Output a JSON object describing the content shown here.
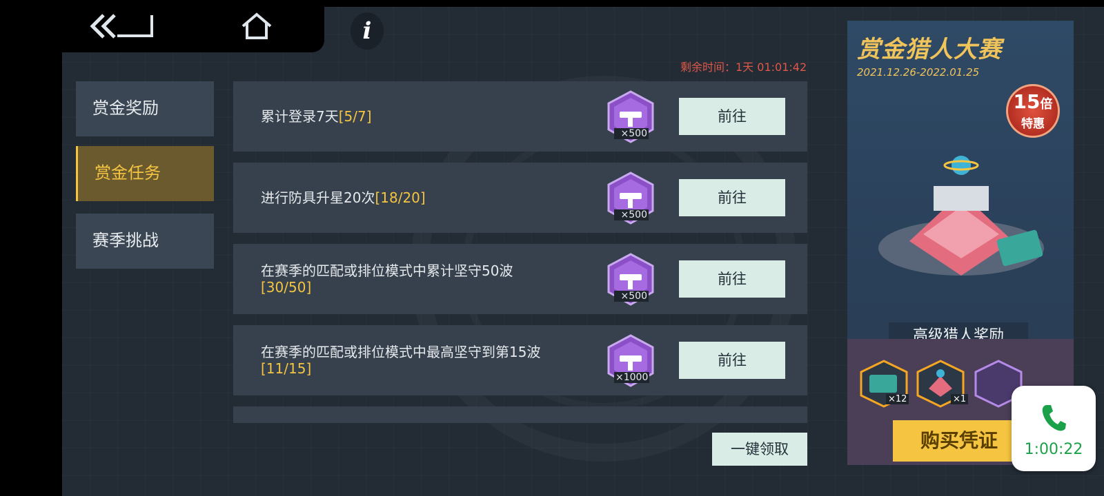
{
  "header": {
    "back_icon": "double-chevron-back-icon",
    "home_icon": "home-icon",
    "info_label": "i"
  },
  "tabs": [
    {
      "label": "赏金奖励",
      "active": false
    },
    {
      "label": "赏金任务",
      "active": true
    },
    {
      "label": "赛季挑战",
      "active": false
    }
  ],
  "timer": "剩余时间：1天 01:01:42",
  "tasks": [
    {
      "text": "累计登录7天",
      "progress": "[5/7]",
      "reward_qty": "×500",
      "button": "前往"
    },
    {
      "text": "进行防具升星20次",
      "progress": "[18/20]",
      "reward_qty": "×500",
      "button": "前往"
    },
    {
      "text": "在赛季的匹配或排位模式中累计坚守50波",
      "progress": "[30/50]",
      "reward_qty": "×500",
      "button": "前往"
    },
    {
      "text": "在赛季的匹配或排位模式中最高坚守到第15波",
      "progress": "[11/15]",
      "reward_qty": "×1000",
      "button": "前往"
    }
  ],
  "claim_all": "一键领取",
  "event": {
    "title": "赏金猎人大赛",
    "dates": "2021.12.26-2022.01.25",
    "badge_number": "15",
    "badge_unit": "倍",
    "badge_text": "特惠",
    "reward_title": "高级猎人奖励",
    "rewards": [
      {
        "icon": "ticket-icon",
        "qty": "×12"
      },
      {
        "icon": "chest-icon",
        "qty": "×1"
      },
      {
        "icon": "gem-icon",
        "qty": ""
      }
    ],
    "buy_label": "购买凭证"
  },
  "call": {
    "icon": "phone-icon",
    "time": "1:00:22"
  },
  "colors": {
    "accent": "#f5c542",
    "timer": "#e0584a",
    "button": "#d9ece5",
    "call_green": "#1aa14a"
  }
}
